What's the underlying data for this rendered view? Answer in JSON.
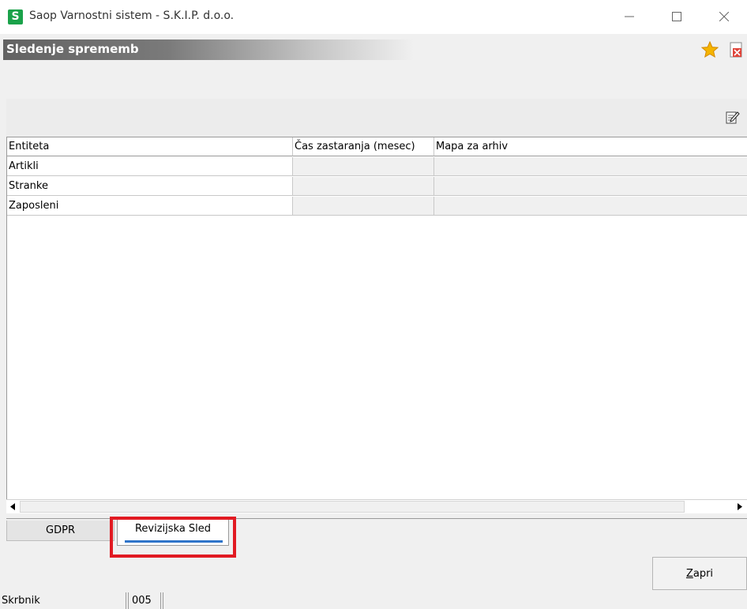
{
  "window": {
    "app_logo_letter": "S",
    "title": "Saop Varnostni sistem - S.K.I.P. d.o.o.",
    "controls": [
      "minimize-icon",
      "maximize-icon",
      "close-icon"
    ]
  },
  "form": {
    "title": "Sledenje sprememb",
    "favorite_icon": "star-icon",
    "close_icon": "close-form-icon",
    "favorite_color": "#f5a800"
  },
  "toolbar": {
    "edit_icon": "edit-icon"
  },
  "grid": {
    "columns": [
      "Entiteta",
      "Čas zastaranja (mesec)",
      "Mapa za arhiv"
    ],
    "rows": [
      [
        "Artikli",
        "",
        ""
      ],
      [
        "Stranke",
        "",
        ""
      ],
      [
        "Zaposleni",
        "",
        ""
      ]
    ]
  },
  "tabs": [
    {
      "label": "GDPR",
      "active": false
    },
    {
      "label": "Revizijska Sled",
      "active": true
    }
  ],
  "buttons": {
    "close_label": "Zapri",
    "close_accel": "Z",
    "close_rest": "apri"
  },
  "status": {
    "user": "Skrbnik",
    "code": "005"
  },
  "colors": {
    "accent": "#2f74c9",
    "highlight": "#e11a22",
    "logo": "#1aa24a"
  }
}
